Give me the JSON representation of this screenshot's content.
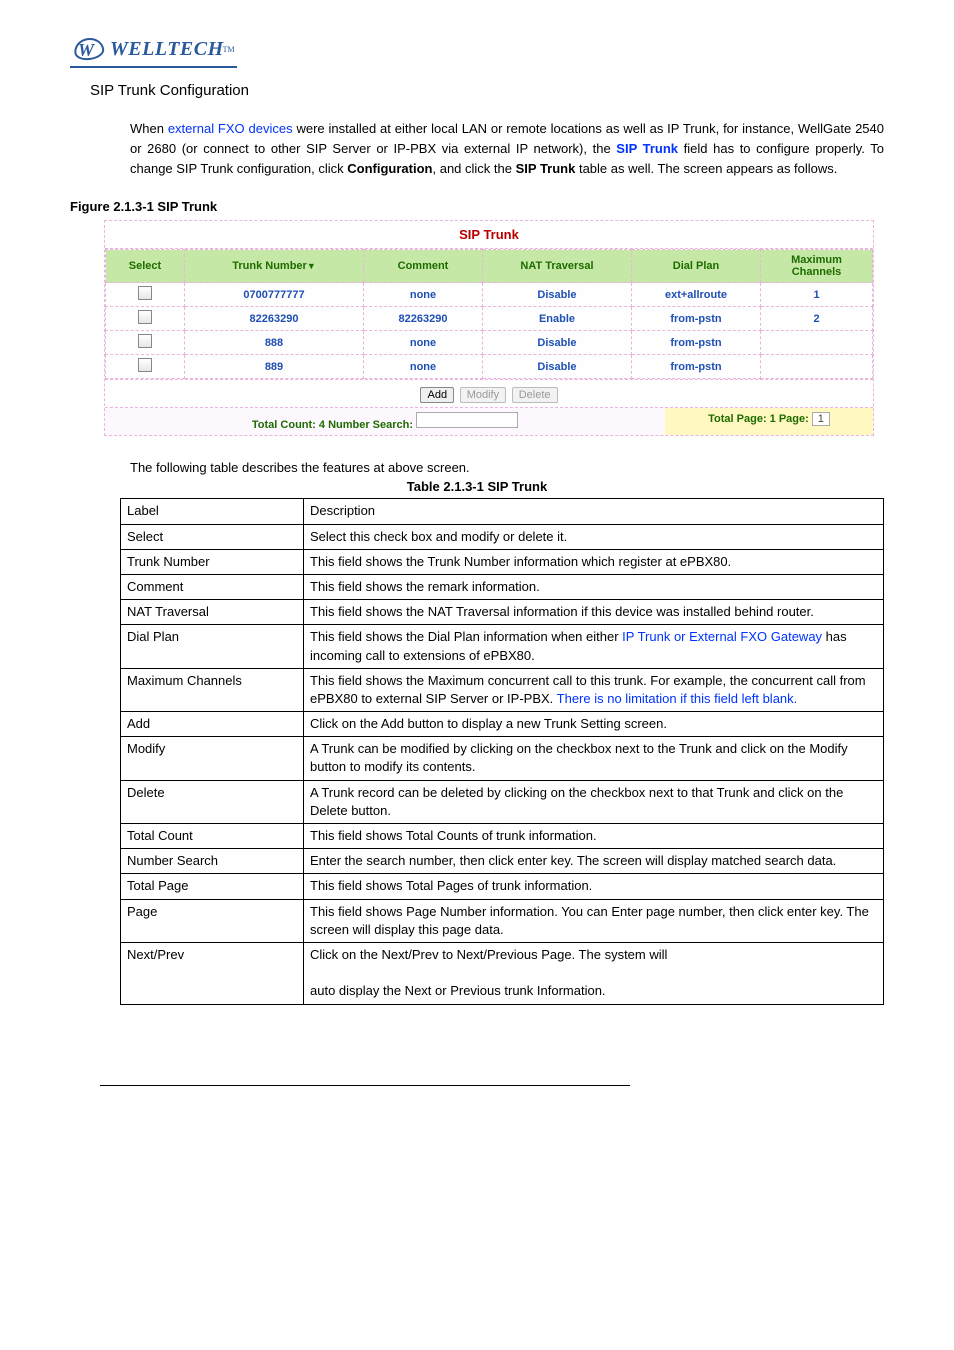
{
  "logo": {
    "text": "WELLTECH",
    "tm": "TM"
  },
  "section_title": "SIP Trunk Configuration",
  "intro": {
    "p1_seg1": "When ",
    "p1_blue1": "external FXO devices",
    "p1_seg2": " were installed at either local LAN or remote locations as well as IP Trunk, for instance, WellGate 2540 or 2680 (or connect to other SIP Server or IP-PBX via external IP network), the ",
    "p1_blue2_bold": "SIP Trunk",
    "p1_seg3": " field has to configure properly. To change SIP Trunk configuration, click ",
    "p1_b1": "Configuration",
    "p1_seg4": ", and click the ",
    "p1_b2": "SIP Trunk",
    "p1_seg5": " table as well. The screen appears as follows."
  },
  "figure_label": "Figure   2.1.3-1 SIP Trunk",
  "sip": {
    "title": "SIP Trunk",
    "headers": {
      "select": "Select",
      "trunk": "Trunk Number",
      "comment": "Comment",
      "nat": "NAT Traversal",
      "dial": "Dial Plan",
      "max": "Maximum Channels"
    },
    "rows": [
      {
        "trunk": "0700777777",
        "comment": "none",
        "nat": "Disable",
        "dial": "ext+allroute",
        "max": "1"
      },
      {
        "trunk": "82263290",
        "comment": "82263290",
        "nat": "Enable",
        "dial": "from-pstn",
        "max": "2"
      },
      {
        "trunk": "888",
        "comment": "none",
        "nat": "Disable",
        "dial": "from-pstn",
        "max": ""
      },
      {
        "trunk": "889",
        "comment": "none",
        "nat": "Disable",
        "dial": "from-pstn",
        "max": ""
      }
    ],
    "buttons": {
      "add": "Add",
      "modify": "Modify",
      "delete": "Delete"
    },
    "footer": {
      "total_count": "Total Count:  4  Number Search:",
      "total_page_prefix": "Total Page:  1  Page:",
      "page_value": "1"
    }
  },
  "desc_intro": "The following table describes the features at above screen.",
  "table_caption": "Table 2.1.3-1 SIP Trunk",
  "desc": {
    "rows": [
      {
        "label": "Label",
        "html": "Description"
      },
      {
        "label": "Select",
        "html": "Select this check box and modify or delete it."
      },
      {
        "label": "Trunk Number",
        "html": "This field shows the Trunk Number information which register at ePBX80."
      },
      {
        "label": "Comment",
        "html": "This field shows the remark information."
      },
      {
        "label": "NAT Traversal",
        "html": "This field shows the NAT Traversal information if this device was installed behind router."
      },
      {
        "label": "Dial Plan",
        "html": "This field shows the Dial Plan information when either <span class='blue-text'>IP Trunk or External FXO Gateway</span> has incoming call to extensions of ePBX80."
      },
      {
        "label": "Maximum Channels",
        "html": "This field shows the Maximum concurrent call to this trunk. For example, the concurrent call from ePBX80 to external SIP Server or IP-PBX. <span class='blue-text'>There is no limitation if this field left blank.</span>"
      },
      {
        "label": "Add",
        "html": "Click on the Add button to display a new Trunk Setting screen."
      },
      {
        "label": "Modify",
        "html": "A Trunk can be modified by clicking on the checkbox next to the Trunk and click on the Modify button to modify its contents."
      },
      {
        "label": "Delete",
        "html": "A Trunk record can be deleted by clicking on the checkbox next to that Trunk and click on the Delete button."
      },
      {
        "label": "Total Count",
        "html": "This field shows Total Counts of trunk information."
      },
      {
        "label": "Number Search",
        "html": "Enter the search number, then click enter key. The screen will display matched search data."
      },
      {
        "label": "Total Page",
        "html": "This field shows Total Pages of trunk information."
      },
      {
        "label": "Page",
        "html": "This field shows Page Number information. You can Enter page number, then click enter key. The screen will display this page data."
      },
      {
        "label": "Next/Prev",
        "html": "Click on the Next/Prev to Next/Previous Page. The system will<br><br>auto display the Next or Previous trunk Information."
      }
    ]
  }
}
